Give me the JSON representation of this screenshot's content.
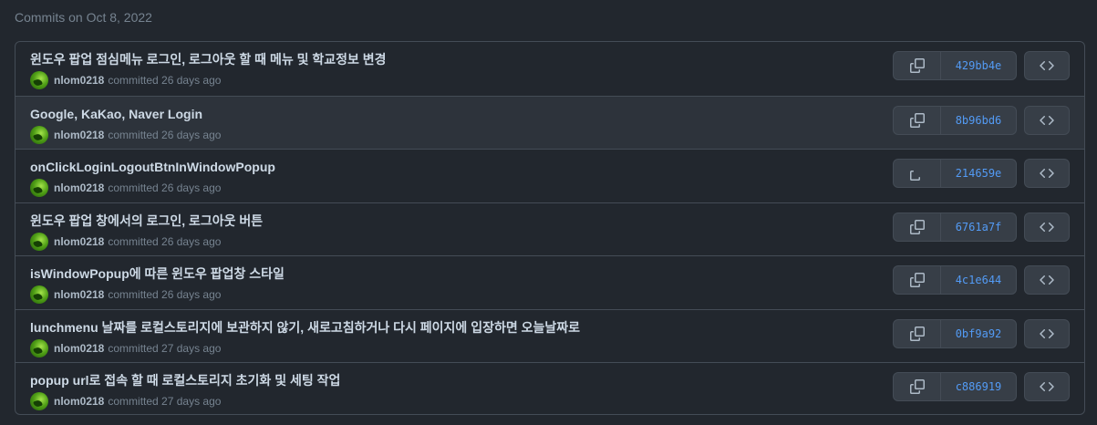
{
  "group": {
    "heading": "Commits on Oct 8, 2022"
  },
  "commits": [
    {
      "title": "윈도우 팝업 점심메뉴 로그인, 로그아웃 할 때 메뉴 및 학교정보 변경",
      "author": "nlom0218",
      "time": "committed 26 days ago",
      "sha": "429bb4e"
    },
    {
      "title": "Google, KaKao, Naver Login",
      "author": "nlom0218",
      "time": "committed 26 days ago",
      "sha": "8b96bd6"
    },
    {
      "title": "onClickLoginLogoutBtnInWindowPopup",
      "author": "nlom0218",
      "time": "committed 26 days ago",
      "sha": "214659e"
    },
    {
      "title": "윈도우 팝업 창에서의 로그인, 로그아웃 버튼",
      "author": "nlom0218",
      "time": "committed 26 days ago",
      "sha": "6761a7f"
    },
    {
      "title": "isWindowPopup에 따른 윈도우 팝업창 스타일",
      "author": "nlom0218",
      "time": "committed 26 days ago",
      "sha": "4c1e644"
    },
    {
      "title": "lunchmenu 날짜를 로컬스토리지에 보관하지 않기, 새로고침하거나 다시 페이지에 입장하면 오늘날짜로",
      "author": "nlom0218",
      "time": "committed 27 days ago",
      "sha": "0bf9a92"
    },
    {
      "title": "popup url로 접속 할 때 로컬스토리지 초기화 및 세팅 작업",
      "author": "nlom0218",
      "time": "committed 27 days ago",
      "sha": "c886919"
    }
  ],
  "icons": {
    "copy": "copy-icon",
    "browse": "code-icon"
  },
  "colors": {
    "background": "#22272e",
    "row_hover": "#2d333b",
    "border": "#444c56",
    "sha_link": "#539bf5",
    "title_text": "#cdd9e5",
    "muted_text": "#768390"
  }
}
